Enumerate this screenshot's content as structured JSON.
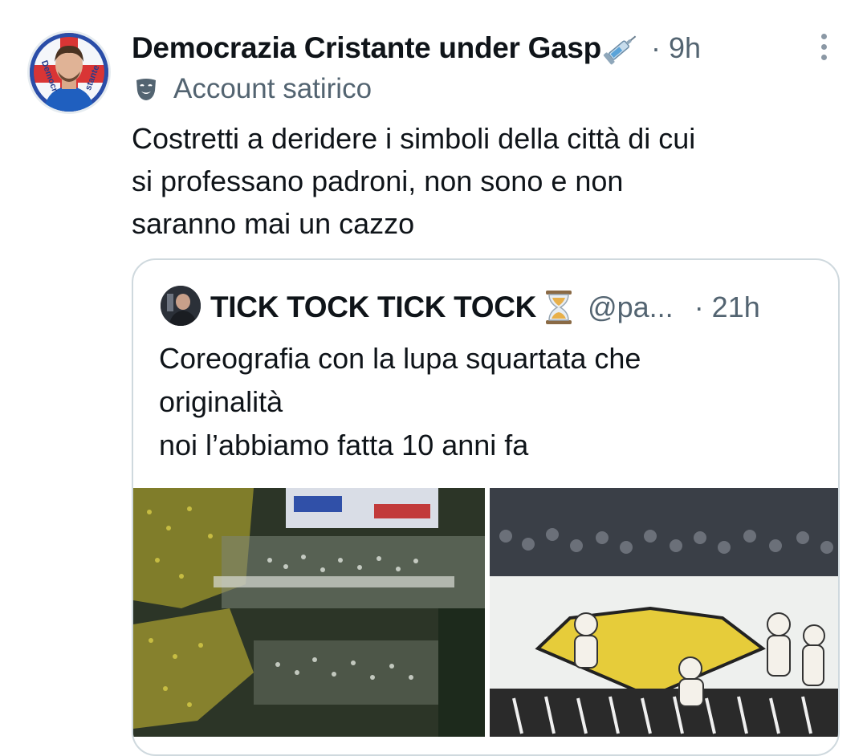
{
  "tweet": {
    "display_name": "Democrazia Cristante under Gasp",
    "name_emoji": "syringe-emoji",
    "time": "· 9h",
    "label": "Account satirico",
    "label_icon": "performing-arts-mask-icon",
    "avatar_text_left": "Democr",
    "avatar_text_right": "stante",
    "text_lines": [
      "Costretti a deridere i simboli della città di cui",
      "si professano padroni, non sono e non",
      "saranno mai un cazzo"
    ]
  },
  "quote": {
    "display_name": "TICK TOCK TICK TOCK",
    "name_emoji": "hourglass-emoji",
    "handle": "@pa...",
    "time": "· 21h",
    "text_lines": [
      "Coreografia con la lupa squartata che",
      "originalità",
      "noi l’abbiamo fatta 10 anni fa"
    ]
  },
  "colors": {
    "text": "#0f1419",
    "secondary": "#536471",
    "border": "#cfd9de"
  }
}
